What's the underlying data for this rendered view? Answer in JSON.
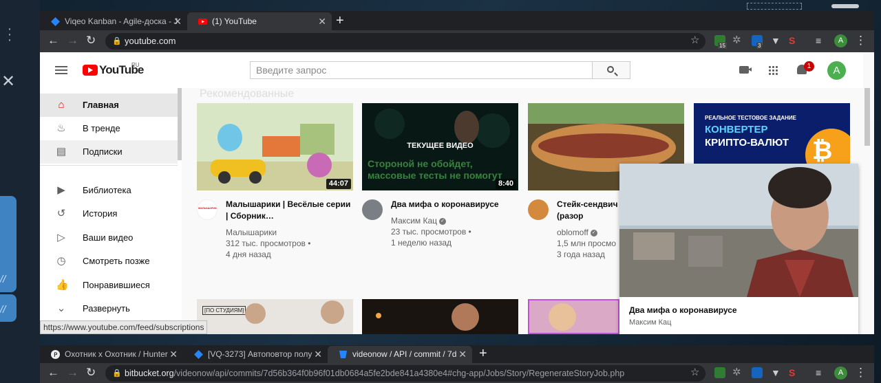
{
  "top_browser": {
    "tabs": [
      {
        "title": "Viqeo Kanban - Agile-доска - J",
        "icon": "jira-diamond-icon"
      },
      {
        "title": "(1) YouTube",
        "icon": "youtube-icon"
      }
    ],
    "url": "youtube.com",
    "extension_badges": {
      "badge_a": "15",
      "badge_b": "3"
    },
    "profile_initial": "A"
  },
  "youtube": {
    "logo_text": "YouTube",
    "logo_region": "RU",
    "search_placeholder": "Введите запрос",
    "notification_count": "1",
    "user_initial": "A",
    "section_title": "Рекомендованные",
    "sidebar": [
      {
        "label": "Главная",
        "icon": "home-icon"
      },
      {
        "label": "В тренде",
        "icon": "flame-icon"
      },
      {
        "label": "Подписки",
        "icon": "subscriptions-icon"
      },
      {
        "label": "Библиотека",
        "icon": "library-icon"
      },
      {
        "label": "История",
        "icon": "history-icon"
      },
      {
        "label": "Ваши видео",
        "icon": "your-videos-icon"
      },
      {
        "label": "Смотреть позже",
        "icon": "watch-later-icon"
      },
      {
        "label": "Понравившиеся",
        "icon": "thumbs-up-icon"
      },
      {
        "label": "Развернуть",
        "icon": "chevron-down-icon"
      }
    ],
    "videos": [
      {
        "title": "Малышарики | Весёлые серии | Сборник…",
        "channel": "Малышарики",
        "views": "312 тыс. просмотров •",
        "age": "4 дня назад",
        "duration": "44:07",
        "channel_avatar_text": "МАЛЫШАРИКИ"
      },
      {
        "title": "Два мифа о коронавирусе",
        "channel": "Максим Кац",
        "views": "23 тыс. просмотров •",
        "age": "1 неделю назад",
        "duration": "8:40",
        "overlay_label": "ТЕКУЩЕЕ ВИДЕО",
        "thumb_caption": "Стороной не обойдет, массовые тесты не помогут"
      },
      {
        "title": "Стейк-сендвич на гриле (разор",
        "channel": "oblomoff",
        "views": "1,5 млн просмо",
        "age": "3 года назад"
      },
      {
        "thumb_top": "РЕАЛЬНОЕ ТЕСТОВОЕ ЗАДАНИЕ",
        "thumb_line1": "КОНВЕРТЕР",
        "thumb_line2": "КРИПТО-ВАЛЮТ"
      }
    ],
    "row2_thumb_label": "[ПО СТУДИЯМ]",
    "miniplayer": {
      "title": "Два мифа о коронавирусе",
      "channel": "Максим Кац"
    },
    "status_url": "https://www.youtube.com/feed/subscriptions"
  },
  "bottom_browser": {
    "tabs": [
      {
        "title": "Охотник х Охотник / Hunter",
        "icon": "p-circle-icon"
      },
      {
        "title": "[VQ-3273] Автоповтор полу",
        "icon": "jira-diamond-icon"
      },
      {
        "title": "videonow / API / commit / 7d",
        "icon": "bitbucket-icon"
      }
    ],
    "url_host": "bitbucket.org",
    "url_path": "/videonow/api/commits/7d56b364f0b96f01db0684a5fe2bde841a4380e4#chg-app/Jobs/Story/RegenerateStoryJob.php"
  },
  "colors": {
    "youtube_red": "#ff0000",
    "chrome_dark": "#202124",
    "chrome_toolbar": "#35363a",
    "jira_blue": "#2684ff"
  }
}
